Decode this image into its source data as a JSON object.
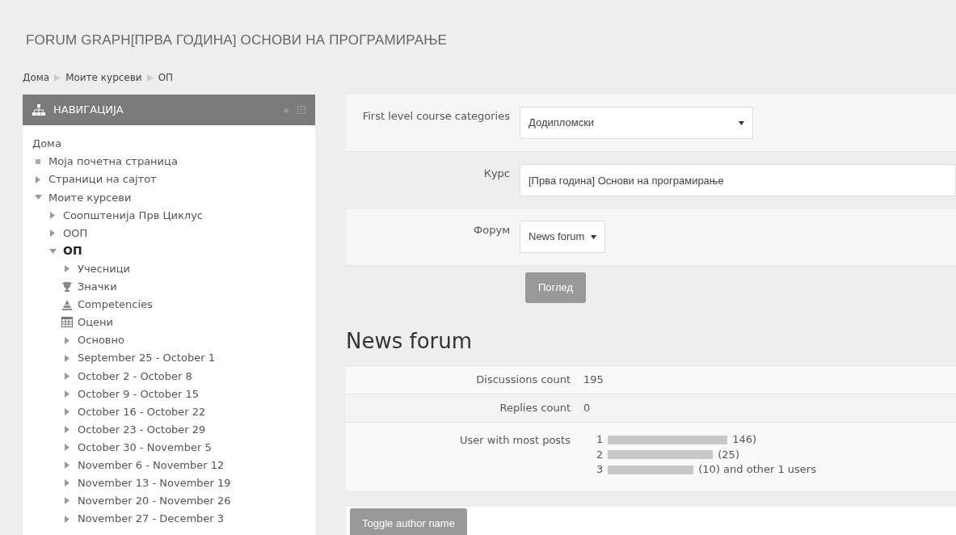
{
  "page_title": "FORUM GRAPH[ПРВА ГОДИНА] ОСНОВИ НА ПРОГРАМИРАЊЕ",
  "breadcrumb": [
    "Дома",
    "Моите курсеви",
    "ОП"
  ],
  "navigation": {
    "title": "НАВИГАЦИЈА",
    "items": [
      {
        "label": "Дома",
        "kind": "plain"
      },
      {
        "label": "Моја почетна страница",
        "kind": "page"
      },
      {
        "label": "Страници на сајтот",
        "kind": "branch",
        "expanded": false
      },
      {
        "label": "Моите курсеви",
        "kind": "branch",
        "expanded": true,
        "children": [
          {
            "label": "Соопштенија Прв Циклус",
            "kind": "branch",
            "expanded": false,
            "current": false
          },
          {
            "label": "ООП",
            "kind": "branch",
            "expanded": false,
            "current": false
          },
          {
            "label": "ОП",
            "kind": "branch",
            "expanded": true,
            "current": true,
            "children": [
              {
                "label": "Учесници",
                "kind": "branch",
                "expanded": false
              },
              {
                "label": "Значки",
                "kind": "badges"
              },
              {
                "label": "Competencies",
                "kind": "competencies"
              },
              {
                "label": "Оцени",
                "kind": "grades"
              },
              {
                "label": "Основно",
                "kind": "branch",
                "expanded": false
              },
              {
                "label": "September 25 - October 1",
                "kind": "branch",
                "expanded": false
              },
              {
                "label": "October 2 - October 8",
                "kind": "branch",
                "expanded": false
              },
              {
                "label": "October 9 - October 15",
                "kind": "branch",
                "expanded": false
              },
              {
                "label": "October 16 - October 22",
                "kind": "branch",
                "expanded": false
              },
              {
                "label": "October 23 - October 29",
                "kind": "branch",
                "expanded": false
              },
              {
                "label": "October 30 - November 5",
                "kind": "branch",
                "expanded": false
              },
              {
                "label": "November 6 - November 12",
                "kind": "branch",
                "expanded": false
              },
              {
                "label": "November 13 - November 19",
                "kind": "branch",
                "expanded": false
              },
              {
                "label": "November 20 - November 26",
                "kind": "branch",
                "expanded": false
              },
              {
                "label": "November 27 - December 3",
                "kind": "branch",
                "expanded": false
              }
            ]
          }
        ]
      }
    ]
  },
  "form": {
    "fields": [
      {
        "label": "First level course categories",
        "kind": "select",
        "value": "Додипломски"
      },
      {
        "label": "Курс",
        "kind": "text",
        "value": "[Прва година] Основи на програмирање"
      },
      {
        "label": "Форум",
        "kind": "select-small",
        "value": "News forum"
      }
    ],
    "submit": "Поглед"
  },
  "stats": {
    "heading": "News forum",
    "rows": [
      {
        "label": "Discussions count",
        "value": "195"
      },
      {
        "label": "Replies count",
        "value": "0"
      }
    ],
    "top_users": {
      "label": "User with most posts",
      "users": [
        {
          "rank": "1",
          "suffix": "146)"
        },
        {
          "rank": "2",
          "suffix": "(25)"
        },
        {
          "rank": "3",
          "suffix": "(10) and other 1 users"
        }
      ]
    }
  },
  "toggle_button": "Toggle author name"
}
